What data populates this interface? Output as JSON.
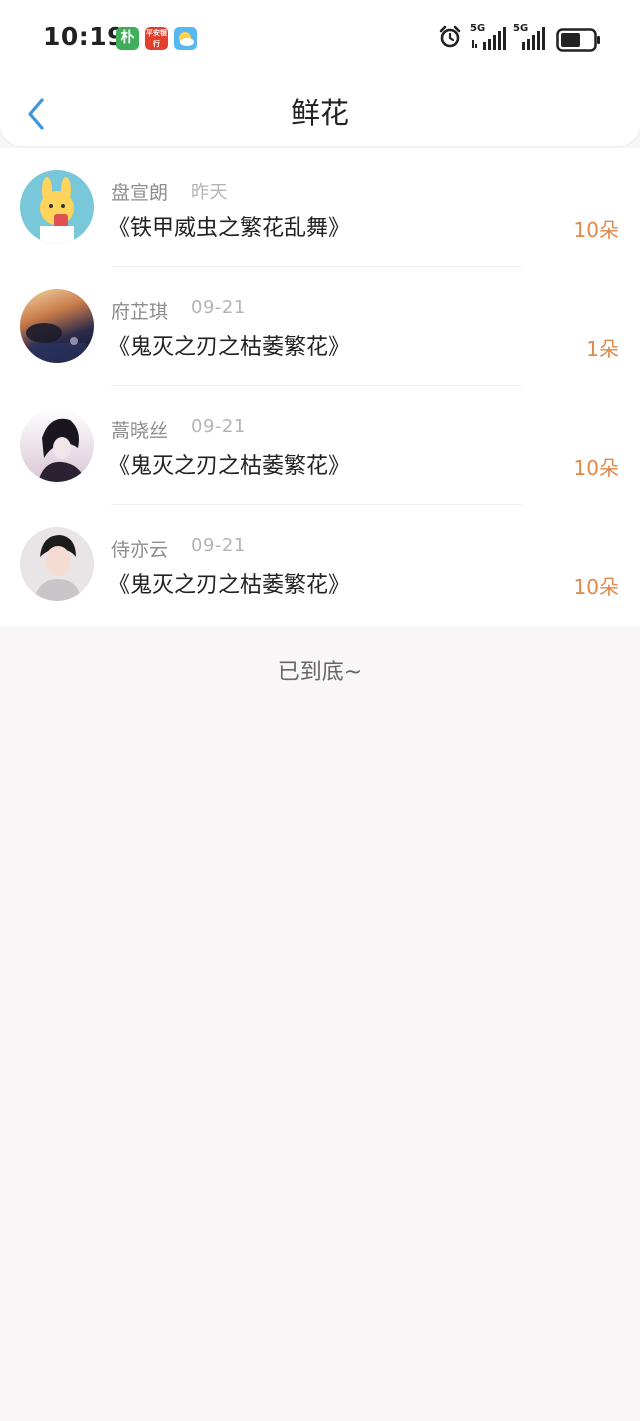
{
  "status_bar": {
    "time": "10:19",
    "badges": [
      {
        "icon": "pu-app-icon",
        "text": "朴",
        "color": "#3fae5b"
      },
      {
        "icon": "pingan-bank-icon",
        "text": "平安银行",
        "color": "#e2402c"
      },
      {
        "icon": "weather-icon",
        "text": "",
        "color": "#58b7ef"
      }
    ],
    "network_1": "5G",
    "network_2": "5G",
    "battery_level": 0.6
  },
  "header": {
    "title": "鲜花",
    "back_icon": "chevron-left-icon"
  },
  "items": [
    {
      "name": "盘宣朗",
      "date": "昨天",
      "book": "《铁甲威虫之繁花乱舞》",
      "count": "10朵"
    },
    {
      "name": "府芷琪",
      "date": "09-21",
      "book": "《鬼灭之刃之枯萎繁花》",
      "count": "1朵"
    },
    {
      "name": "蒿晓丝",
      "date": "09-21",
      "book": "《鬼灭之刃之枯萎繁花》",
      "count": "10朵"
    },
    {
      "name": "侍亦云",
      "date": "09-21",
      "book": "《鬼灭之刃之枯萎繁花》",
      "count": "10朵"
    }
  ],
  "footer": {
    "end_text": "已到底~"
  },
  "colors": {
    "accent": "#3b97e0",
    "count": "#e0884a",
    "background": "#f8f6f7"
  }
}
